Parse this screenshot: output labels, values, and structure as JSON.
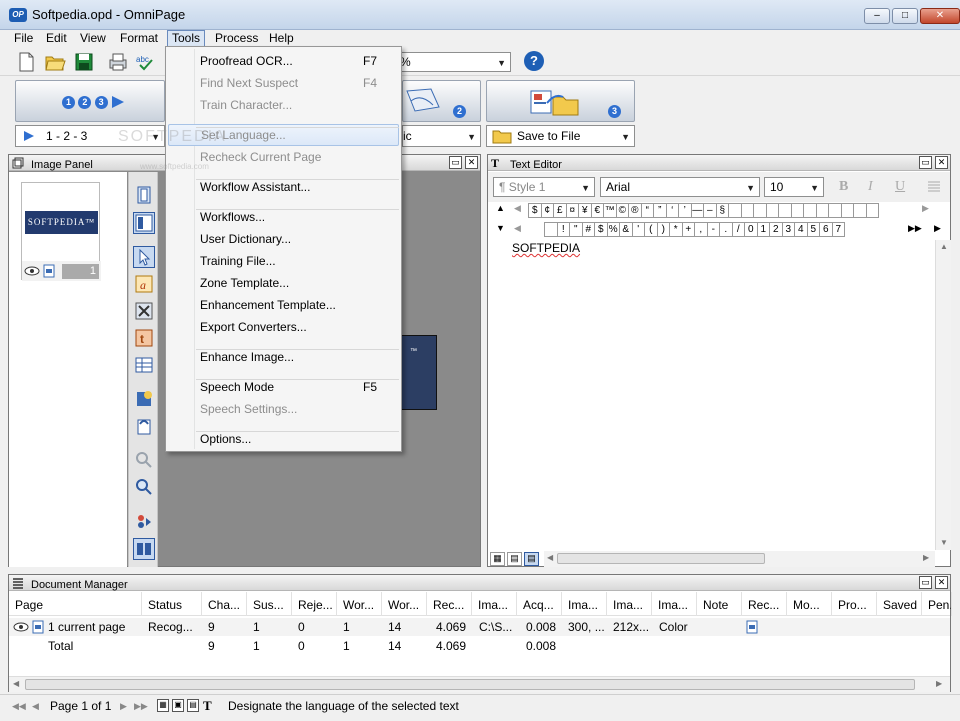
{
  "window": {
    "title": "Softpedia.opd - OmniPage",
    "app_icon": "OP",
    "minimize": "–",
    "maximize": "□",
    "close": "✕"
  },
  "menubar": [
    "File",
    "Edit",
    "View",
    "Format",
    "Tools",
    "Process",
    "Help"
  ],
  "toolbar": {
    "zoom_value": "%",
    "help": "?"
  },
  "workflow": {
    "step1_combo": "1 - 2 - 3",
    "step2_combo": "ic",
    "step3_combo": "Save to File",
    "badges": [
      "1",
      "2",
      "3"
    ]
  },
  "tools_menu": {
    "items": [
      {
        "label": "Proofread OCR...",
        "shortcut": "F7",
        "disabled": false
      },
      {
        "label": "Find Next Suspect",
        "shortcut": "F4",
        "disabled": true
      },
      {
        "label": "Train Character...",
        "shortcut": "",
        "disabled": true
      },
      {
        "label": "Set Language...",
        "shortcut": "",
        "disabled": true,
        "highlighted": true
      },
      {
        "label": "Recheck Current Page",
        "shortcut": "",
        "disabled": true
      },
      {
        "label": "Workflow Assistant...",
        "shortcut": "",
        "disabled": false
      },
      {
        "label": "Workflows...",
        "shortcut": "",
        "disabled": false
      },
      {
        "label": "User Dictionary...",
        "shortcut": "",
        "disabled": false
      },
      {
        "label": "Training File...",
        "shortcut": "",
        "disabled": false
      },
      {
        "label": "Zone Template...",
        "shortcut": "",
        "disabled": false
      },
      {
        "label": "Enhancement Template...",
        "shortcut": "",
        "disabled": false
      },
      {
        "label": "Export Converters...",
        "shortcut": "",
        "disabled": false
      },
      {
        "label": "Enhance Image...",
        "shortcut": "",
        "disabled": false
      },
      {
        "label": "Speech Mode",
        "shortcut": "F5",
        "disabled": false
      },
      {
        "label": "Speech Settings...",
        "shortcut": "",
        "disabled": true
      },
      {
        "label": "Options...",
        "shortcut": "",
        "disabled": false
      }
    ]
  },
  "image_panel": {
    "title": "Image Panel",
    "thumb_logo": "SOFTPEDIA™",
    "thumb_page_num": "1",
    "page_mark": "™"
  },
  "text_editor": {
    "title": "Text Editor",
    "style_combo": "¶  Style 1",
    "font_combo": "Arial",
    "size_combo": "10",
    "bold": "B",
    "italic": "I",
    "underline": "U",
    "chars_row1": [
      "$",
      "¢",
      "£",
      "¤",
      "¥",
      "€",
      "™",
      "©",
      "®",
      "“",
      "”",
      "‘",
      "’",
      "—",
      "–",
      "§",
      "",
      "",
      "",
      "",
      "",
      "",
      "",
      "",
      "",
      "",
      "",
      ""
    ],
    "chars_row2": [
      "",
      "!",
      "\"",
      "#",
      "$",
      "%",
      "&",
      "'",
      "(",
      ")",
      "*",
      "+",
      ",",
      "-",
      ".",
      "/",
      "0",
      "1",
      "2",
      "3",
      "4",
      "5",
      "6",
      "7"
    ],
    "body_text": "SOFTPEDIA"
  },
  "doc_manager": {
    "title": "Document Manager",
    "columns": [
      "Page",
      "Status",
      "Cha...",
      "Sus...",
      "Reje...",
      "Wor...",
      "Wor...",
      "Rec...",
      "Ima...",
      "Acq...",
      "Ima...",
      "Ima...",
      "Ima...",
      "Note",
      "Rec...",
      "Mo...",
      "Pro...",
      "Saved",
      "Pen..."
    ],
    "rows": [
      {
        "page": "1 current page",
        "status": "Recog...",
        "cha": "9",
        "sus": "1",
        "reje": "0",
        "wor1": "1",
        "wor2": "14",
        "rec": "4.069",
        "ima1": "C:\\S...",
        "acq": "0.008",
        "ima2": "300, ...",
        "ima3": "212x...",
        "ima4": "Color"
      },
      {
        "page": "Total",
        "status": "",
        "cha": "9",
        "sus": "1",
        "reje": "0",
        "wor1": "1",
        "wor2": "14",
        "rec": "4.069",
        "ima1": "",
        "acq": "0.008",
        "ima2": "",
        "ima3": "",
        "ima4": ""
      }
    ]
  },
  "statusbar": {
    "page_info": "Page 1 of 1",
    "message": "Designate the language of the selected text"
  },
  "watermark": "SOFTPEDIA",
  "watermark_small": "www.softpedia.com"
}
